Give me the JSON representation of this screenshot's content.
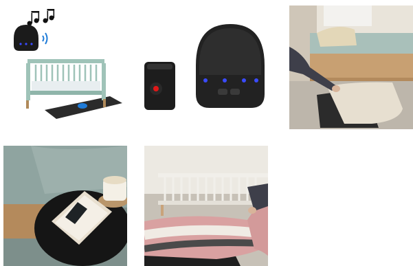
{
  "gallery": {
    "images": [
      {
        "name": "product-illustration-crib-with-speaker-and-mat"
      },
      {
        "name": "product-receiver-and-speaker"
      },
      {
        "name": "mat-under-bed-rug-photo"
      },
      {
        "name": "bedside-table-with-receiver-photo"
      },
      {
        "name": "crib-with-mat-under-rug-photo"
      }
    ]
  },
  "colors": {
    "accent_led": "#3a4bff",
    "crib": "#9fc3b8",
    "mat": "#2b2b2b"
  }
}
